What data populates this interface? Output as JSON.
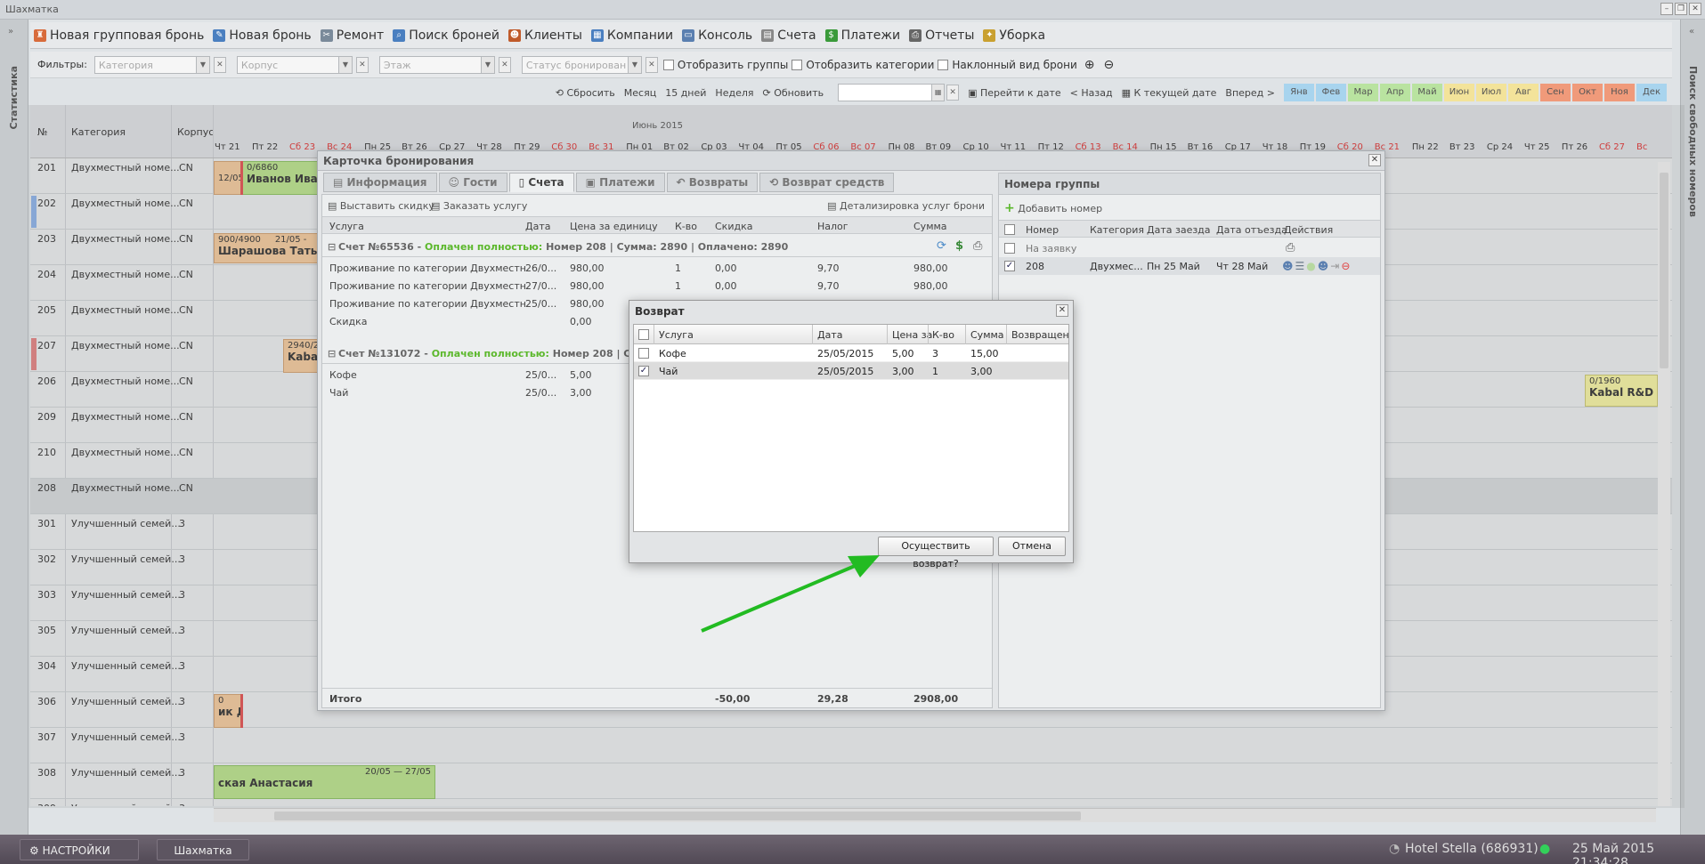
{
  "window": {
    "title": "Шахматка"
  },
  "side": {
    "left_label": "Статистика",
    "right_label": "Поиск свободных номеров"
  },
  "toolbar": {
    "items": [
      {
        "label": "Новая групповая бронь",
        "icon": "group-booking-icon"
      },
      {
        "label": "Новая бронь",
        "icon": "booking-icon"
      },
      {
        "label": "Ремонт",
        "icon": "wrench-icon"
      },
      {
        "label": "Поиск броней",
        "icon": "search-icon"
      },
      {
        "label": "Клиенты",
        "icon": "clients-icon"
      },
      {
        "label": "Компании",
        "icon": "company-icon"
      },
      {
        "label": "Консоль",
        "icon": "console-icon"
      },
      {
        "label": "Счета",
        "icon": "invoice-icon"
      },
      {
        "label": "Платежи",
        "icon": "dollar-icon"
      },
      {
        "label": "Отчеты",
        "icon": "printer-icon"
      },
      {
        "label": "Уборка",
        "icon": "broom-icon"
      }
    ]
  },
  "filters": {
    "label": "Фильтры:",
    "category_placeholder": "Категория",
    "building_placeholder": "Корпус",
    "floor_placeholder": "Этаж",
    "status_placeholder": "Статус бронирован",
    "show_groups": "Отобразить группы",
    "show_categories": "Отобразить категории",
    "tilted_view": "Наклонный вид брони"
  },
  "nav": {
    "reset": "Сбросить",
    "month": "Месяц",
    "days15": "15 дней",
    "week": "Неделя",
    "refresh": "Обновить",
    "goto_date": "Перейти к дате",
    "back": "< Назад",
    "to_current": "К текущей дате",
    "forward": "Вперед >",
    "months": [
      {
        "label": "Янв",
        "color": "#a8d4ee"
      },
      {
        "label": "Фев",
        "color": "#a8d4ee"
      },
      {
        "label": "Мар",
        "color": "#b9e3a0"
      },
      {
        "label": "Апр",
        "color": "#b9e3a0"
      },
      {
        "label": "Май",
        "color": "#b9e3a0"
      },
      {
        "label": "Июн",
        "color": "#f3e39a"
      },
      {
        "label": "Июл",
        "color": "#f3e39a"
      },
      {
        "label": "Авг",
        "color": "#f3e39a"
      },
      {
        "label": "Сен",
        "color": "#f09a7a"
      },
      {
        "label": "Окт",
        "color": "#f09a7a"
      },
      {
        "label": "Ноя",
        "color": "#f09a7a"
      },
      {
        "label": "Дек",
        "color": "#a8d4ee"
      }
    ]
  },
  "grid": {
    "col_num": "№",
    "col_category": "Категория",
    "col_building": "Корпус",
    "month_label": "Июнь 2015",
    "days": [
      {
        "d": "Чт 21",
        "red": false
      },
      {
        "d": "Пт 22",
        "red": false
      },
      {
        "d": "Сб 23",
        "red": true
      },
      {
        "d": "Вс 24",
        "red": true
      },
      {
        "d": "Пн 25",
        "red": false
      },
      {
        "d": "Вт 26",
        "red": false
      },
      {
        "d": "Ср 27",
        "red": false
      },
      {
        "d": "Чт 28",
        "red": false
      },
      {
        "d": "Пт 29",
        "red": false
      },
      {
        "d": "Сб 30",
        "red": true
      },
      {
        "d": "Вс 31",
        "red": true
      },
      {
        "d": "Пн 01",
        "red": false
      },
      {
        "d": "Вт 02",
        "red": false
      },
      {
        "d": "Ср 03",
        "red": false
      },
      {
        "d": "Чт 04",
        "red": false
      },
      {
        "d": "Пт 05",
        "red": false
      },
      {
        "d": "Сб 06",
        "red": true
      },
      {
        "d": "Вс 07",
        "red": true
      },
      {
        "d": "Пн 08",
        "red": false
      },
      {
        "d": "Вт 09",
        "red": false
      },
      {
        "d": "Ср 10",
        "red": false
      },
      {
        "d": "Чт 11",
        "red": false
      },
      {
        "d": "Пт 12",
        "red": false
      },
      {
        "d": "Сб 13",
        "red": true
      },
      {
        "d": "Вс 14",
        "red": true
      },
      {
        "d": "Пн 15",
        "red": false
      },
      {
        "d": "Вт 16",
        "red": false
      },
      {
        "d": "Ср 17",
        "red": false
      },
      {
        "d": "Чт 18",
        "red": false
      },
      {
        "d": "Пт 19",
        "red": false
      },
      {
        "d": "Сб 20",
        "red": true
      },
      {
        "d": "Вс 21",
        "red": true
      },
      {
        "d": "Пн 22",
        "red": false
      },
      {
        "d": "Вт 23",
        "red": false
      },
      {
        "d": "Ср 24",
        "red": false
      },
      {
        "d": "Чт 25",
        "red": false
      },
      {
        "d": "Пт 26",
        "red": false
      },
      {
        "d": "Сб 27",
        "red": true
      },
      {
        "d": "Вс",
        "red": true
      }
    ],
    "rows": [
      {
        "num": "201",
        "cat": "Двухместный номе...",
        "korp": "CN"
      },
      {
        "num": "202",
        "cat": "Двухместный номе...",
        "korp": "CN"
      },
      {
        "num": "203",
        "cat": "Двухместный номе...",
        "korp": "CN"
      },
      {
        "num": "204",
        "cat": "Двухместный номе...",
        "korp": "CN"
      },
      {
        "num": "205",
        "cat": "Двухместный номе...",
        "korp": "CN"
      },
      {
        "num": "207",
        "cat": "Двухместный номе...",
        "korp": "CN"
      },
      {
        "num": "206",
        "cat": "Двухместный номе...",
        "korp": "CN"
      },
      {
        "num": "209",
        "cat": "Двухместный номе...",
        "korp": "CN"
      },
      {
        "num": "210",
        "cat": "Двухместный номе...",
        "korp": "CN"
      },
      {
        "num": "208",
        "cat": "Двухместный номе...",
        "korp": "CN"
      },
      {
        "num": "301",
        "cat": "Улучшенный семей...",
        "korp": "3"
      },
      {
        "num": "302",
        "cat": "Улучшенный семей...",
        "korp": "3"
      },
      {
        "num": "303",
        "cat": "Улучшенный семей...",
        "korp": "3"
      },
      {
        "num": "305",
        "cat": "Улучшенный семей...",
        "korp": "3"
      },
      {
        "num": "304",
        "cat": "Улучшенный семей...",
        "korp": "3"
      },
      {
        "num": "306",
        "cat": "Улучшенный семей...",
        "korp": "3"
      },
      {
        "num": "307",
        "cat": "Улучшенный семей...",
        "korp": "3"
      },
      {
        "num": "308",
        "cat": "Улучшенный семей...",
        "korp": "3"
      },
      {
        "num": "309",
        "cat": "Улучшенный семей...",
        "korp": "3"
      }
    ],
    "bookings": {
      "b1_top": "0/6860",
      "b1_name": "Иванов Иван",
      "b1_left": "12/05",
      "b3_top": "900/4900",
      "b3_date": "21/05 -",
      "b3_name": "Шарашова Татьяна",
      "b7_top": "2940/2",
      "b7_name": "Kabal",
      "b306_top": "0",
      "b306_name": "ик Д",
      "b308_date": "20/05 — 27/05",
      "b308_name": "ская Анастасия",
      "kabal_top": "0/1960",
      "kabal_name": "Kabal R&D"
    }
  },
  "card": {
    "title": "Карточка бронирования",
    "tabs": [
      "Информация",
      "Гости",
      "Счета",
      "Платежи",
      "Возвраты",
      "Возврат средств"
    ],
    "discount_btn": "Выставить скидку",
    "order_btn": "Заказать услугу",
    "details_btn": "Детализировка услуг брони",
    "cols": [
      "Услуга",
      "Дата",
      "Цена за единицу",
      "К-во",
      "Скидка",
      "Налог",
      "Сумма"
    ],
    "invoice1_title": "Счет №65536",
    "invoice1_status": "Оплачен полностью:",
    "invoice1_info": "Номер 208 | Сумма: 2890 | Оплачено: 2890",
    "invoice1_rows": [
      {
        "name": "Проживание по категории Двухместный...",
        "date": "26/0...",
        "price": "980,00",
        "qty": "1",
        "disc": "0,00",
        "tax": "9,70",
        "sum": "980,00"
      },
      {
        "name": "Проживание по категории Двухместный...",
        "date": "27/0...",
        "price": "980,00",
        "qty": "1",
        "disc": "0,00",
        "tax": "9,70",
        "sum": "980,00"
      },
      {
        "name": "Проживание по категории Двухместный...",
        "date": "25/0...",
        "price": "980,00",
        "qty": "",
        "disc": "",
        "tax": "",
        "sum": ""
      },
      {
        "name": "Скидка",
        "date": "",
        "price": "0,00",
        "qty": "",
        "disc": "",
        "tax": "",
        "sum": ""
      }
    ],
    "invoice2_title": "Счет №131072",
    "invoice2_status": "Оплачен полностью:",
    "invoice2_info": "Номер 208 | Сумма",
    "invoice2_rows": [
      {
        "name": "Кофе",
        "date": "25/0...",
        "price": "5,00"
      },
      {
        "name": "Чай",
        "date": "25/0...",
        "price": "3,00"
      }
    ],
    "total_label": "Итого",
    "total_disc": "-50,00",
    "total_tax": "29,28",
    "total_sum": "2908,00"
  },
  "group": {
    "title": "Номера группы",
    "add_btn": "Добавить номер",
    "cols": [
      "Номер",
      "Категория",
      "Дата заезда",
      "Дата отъезда",
      "Действия"
    ],
    "row_request": "На заявку",
    "row": {
      "num": "208",
      "cat": "Двухмес...",
      "in": "Пн 25 Май",
      "out": "Чт 28 Май"
    }
  },
  "dialog": {
    "title": "Возврат",
    "cols": [
      "Услуга",
      "Дата",
      "Цена за",
      "К-во",
      "Сумма",
      "Возвращен"
    ],
    "rows": [
      {
        "name": "Кофе",
        "date": "25/05/2015",
        "price": "5,00",
        "qty": "3",
        "sum": "15,00",
        "checked": false
      },
      {
        "name": "Чай",
        "date": "25/05/2015",
        "price": "3,00",
        "qty": "1",
        "sum": "3,00",
        "checked": true
      }
    ],
    "confirm_btn": "Осуществить возврат?",
    "cancel_btn": "Отмена"
  },
  "taskbar": {
    "settings": "НАСТРОЙКИ",
    "chess": "Шахматка",
    "hotel": "Hotel Stella (686931)",
    "datetime": "25 Май 2015 21:34:28"
  }
}
